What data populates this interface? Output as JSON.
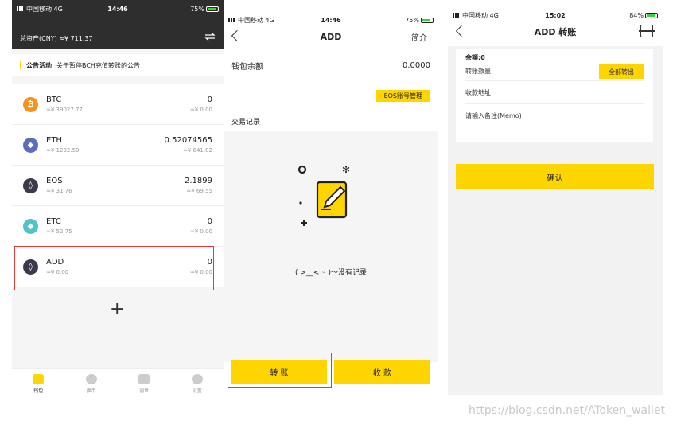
{
  "screen1": {
    "status": {
      "carrier": "中国移动",
      "net": "4G",
      "time": "14:46",
      "battery": "75%"
    },
    "total_label": "总资产(CNY) ≈¥ 711.37",
    "notice": {
      "title": "公告活动",
      "text": "关于暂停BCH充值转账的公告"
    },
    "coins": [
      {
        "name": "BTC",
        "price": "≈¥ 39027.77",
        "amount": "0",
        "value": "≈¥ 0.00",
        "icon": "bitcoin-icon",
        "color": "#f7931a",
        "glyph": "₿"
      },
      {
        "name": "ETH",
        "price": "≈¥ 1232.50",
        "amount": "0.52074565",
        "value": "≈¥ 641.82",
        "icon": "ethereum-icon",
        "color": "#5c6bc0",
        "glyph": "◆"
      },
      {
        "name": "EOS",
        "price": "≈¥ 31.76",
        "amount": "2.1899",
        "value": "≈¥ 69.55",
        "icon": "eos-icon",
        "color": "#3a3a4a",
        "glyph": "◊"
      },
      {
        "name": "ETC",
        "price": "≈¥ 52.75",
        "amount": "0",
        "value": "≈¥ 0.00",
        "icon": "etc-icon",
        "color": "#4fc3c7",
        "glyph": "◆"
      },
      {
        "name": "ADD",
        "price": "≈¥ 0.00",
        "amount": "0",
        "value": "≈¥ 0.00",
        "icon": "add-coin-icon",
        "color": "#3a3a4a",
        "glyph": "◊"
      }
    ],
    "add_symbol": "+",
    "tabs": [
      {
        "label": "钱包",
        "active": true
      },
      {
        "label": "换币",
        "active": false
      },
      {
        "label": "创世",
        "active": false
      },
      {
        "label": "设置",
        "active": false
      }
    ]
  },
  "screen2": {
    "status": {
      "carrier": "中国移动",
      "net": "4G",
      "time": "14:46",
      "battery": "75%"
    },
    "title": "ADD",
    "right_link": "简介",
    "balance_label": "钱包余额",
    "balance_value": "0.0000",
    "eos_button": "EOS账号管理",
    "records_label": "交易记录",
    "empty_text": "( >__< ◦ )～没有记录",
    "transfer_button": "转 账",
    "receive_button": "收 款"
  },
  "screen3": {
    "status": {
      "carrier": "中国移动",
      "net": "4G",
      "time": "15:02",
      "battery": "84%"
    },
    "title": "ADD 转账",
    "balance_label": "余额:0",
    "amount_placeholder": "转账数量",
    "all_out_button": "全部转出",
    "address_placeholder": "收款地址",
    "memo_placeholder": "请输入备注(Memo)",
    "confirm_button": "确认"
  },
  "watermark": "https://blog.csdn.net/AToken_wallet",
  "colors": {
    "accent": "#ffd500",
    "highlight": "#e53935",
    "dark_header": "#2e2e2e"
  }
}
